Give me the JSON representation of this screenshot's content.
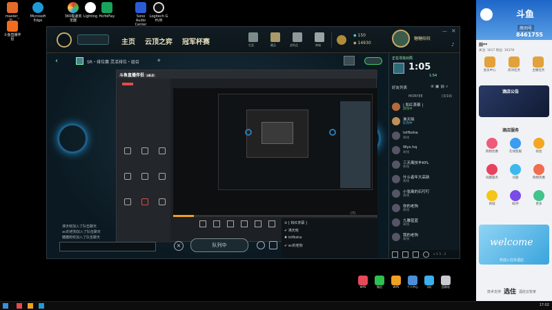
{
  "desktop_icons": [
    {
      "label": "master_万..."
    },
    {
      "label": "Microsoft Edge"
    },
    {
      "label": "360极速浏览器"
    },
    {
      "label": "Lighting"
    },
    {
      "label": "HoYoPlay"
    },
    {
      "label": "Sono Audio Center"
    },
    {
      "label": "Logitech G HUB"
    },
    {
      "label": "斗鱼直播伴侣"
    }
  ],
  "lol": {
    "tabs": [
      "主页",
      "云顶之弈",
      "冠军杯赛"
    ],
    "top_icons": [
      "生涯",
      "藏品",
      "战利品",
      "商城"
    ],
    "currency_be": "150",
    "currency_rp": "14930",
    "player_name": "糖糖皎皎",
    "queue_title": "SR・排位赛 灵活排位・组召",
    "queue_timer_label": "正在寻找对局",
    "queue_timer": "1:05",
    "queue_estimate": "1:54",
    "friends_header": "好友列表",
    "friends_group": "MORYEE",
    "friends_count": "(3/19)",
    "friends": [
      {
        "name": "| 和红茶蔡 |",
        "status": "游戏中",
        "color": "#66c25a",
        "av": "#b56a3a"
      },
      {
        "name": "沸天晓",
        "status": "队列中",
        "color": "#57b7e0",
        "av": "#c0905a"
      },
      {
        "name": "lolfbsha",
        "status": "离线",
        "color": "#7f8a8f",
        "av": "#556"
      },
      {
        "name": "Wys.hq",
        "status": "离线",
        "color": "#7f8a8f",
        "av": "#556"
      },
      {
        "name": "三天离技丰KPL",
        "status": "离线",
        "color": "#7f8a8f",
        "av": "#556"
      },
      {
        "name": "什么者年大高新",
        "status": "离线",
        "color": "#7f8a8f",
        "av": "#556"
      },
      {
        "name": "小张离的石叮叮",
        "status": "离线",
        "color": "#7f8a8f",
        "av": "#556"
      },
      {
        "name": "你的老狗",
        "status": "离线",
        "color": "#7f8a8f",
        "av": "#556"
      },
      {
        "name": "九雕蓝蓝",
        "status": "离线",
        "color": "#7f8a8f",
        "av": "#556"
      },
      {
        "name": "我的老狗",
        "status": "离线",
        "color": "#7f8a8f",
        "av": "#556"
      }
    ],
    "chat_lines": [
      "沸天晓加入了队伍聊天",
      "ac的老狗加入了队伍聊天",
      "糖糖皎皎加入了队伍聊天"
    ],
    "queue_list": [
      {
        "mark": "⊘",
        "text": "[ 和红茶蔡 ]"
      },
      {
        "mark": "✔",
        "text": "沸天晓"
      },
      {
        "mark": "✖",
        "text": "lolfbsha"
      },
      {
        "mark": "✔",
        "text": "ac的老狗"
      }
    ],
    "queue_list_count": "(7)",
    "in_queue_button": "队列中",
    "version": "v 1 5 . 2"
  },
  "stream_app": {
    "title": "斗鱼直播伴侣",
    "version_badge": "v6.3",
    "side_items": [
      "直播设置",
      "录屏",
      "画中画",
      "场景素材",
      "主播任务",
      "弹幕助手",
      "礼物助手",
      "更多工具"
    ],
    "toolbar": [
      "游戏素材",
      "视频",
      "场景切换",
      "画中画",
      "录音",
      "麦克风",
      "摄像头",
      "分享"
    ]
  },
  "douyu_panel": {
    "logo": "斗鱼",
    "room_label": "房间号",
    "room_id": "8461755",
    "user": "田**",
    "stats": "关注: 1617  粉丝: 16378",
    "row1": [
      "会员中心",
      "房间任务",
      "主播任务"
    ],
    "services_title": "酒店服务",
    "services": [
      {
        "label": "购物优惠",
        "color": "#ef5a7a"
      },
      {
        "label": "在线客服",
        "color": "#3b9cf0"
      },
      {
        "label": "续住",
        "color": "#f5a623"
      },
      {
        "label": "叫醒服务",
        "color": "#e8415f"
      },
      {
        "label": "问题",
        "color": "#3db8ef"
      },
      {
        "label": "购物优惠",
        "color": "#f26c4f"
      },
      {
        "label": "商城",
        "color": "#f5c518"
      },
      {
        "label": "I助手",
        "color": "#7a4be8"
      },
      {
        "label": "更多",
        "color": "#43c28a"
      }
    ],
    "welcome": "welcome",
    "welcome_sub": "欢迎入住本酒店",
    "footer_left": "技术支持",
    "footer_brand": "选住",
    "footer_right": "酒店云管家",
    "notice": "酒店公告"
  },
  "dock": [
    "WPS",
    "微信",
    "WPS",
    "个人中心",
    "QQ",
    "回收站"
  ],
  "taskbar_time": "17:02"
}
